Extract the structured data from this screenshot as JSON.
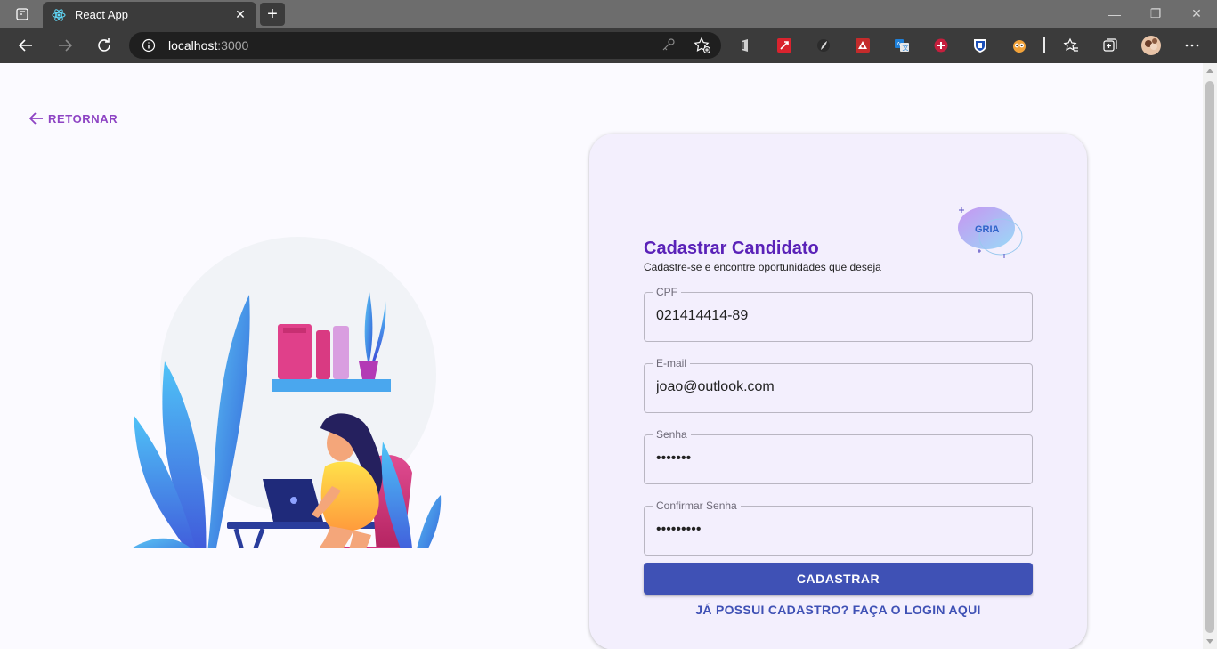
{
  "browser": {
    "tab_title": "React App",
    "new_tab_symbol": "+",
    "url_host": "localhost",
    "url_port": ":3000",
    "window_controls": {
      "minimize": "—",
      "restore": "❐",
      "close": "✕"
    },
    "tab_close": "✕"
  },
  "page": {
    "back_label": "RETORNAR",
    "logo_text": "GRIA",
    "form": {
      "title": "Cadastrar Candidato",
      "subtitle": "Cadastre-se e encontre oportunidades que deseja",
      "fields": [
        {
          "label": "CPF",
          "value": "021414414-89",
          "type": "text"
        },
        {
          "label": "E-mail",
          "value": "joao@outlook.com",
          "type": "text"
        },
        {
          "label": "Senha",
          "value": "•••••••",
          "type": "password"
        },
        {
          "label": "Confirmar Senha",
          "value": "•••••••••",
          "type": "password"
        }
      ],
      "submit_label": "CADASTRAR",
      "login_link": "JÁ POSSUI CADASTRO? FAÇA O LOGIN AQUI"
    }
  },
  "colors": {
    "accent": "#3f51b5",
    "title": "#5a22b8",
    "back_link": "#8e44c4",
    "card_bg": "#f3effd"
  },
  "icons": [
    "tab-actions-icon",
    "react-icon",
    "back-icon",
    "forward-icon",
    "refresh-icon",
    "info-icon",
    "key-icon",
    "add-favorite-icon",
    "office-icon",
    "extension-icons",
    "favorites-icon",
    "collections-icon",
    "profile-avatar",
    "more-icon",
    "arrow-left-icon"
  ]
}
